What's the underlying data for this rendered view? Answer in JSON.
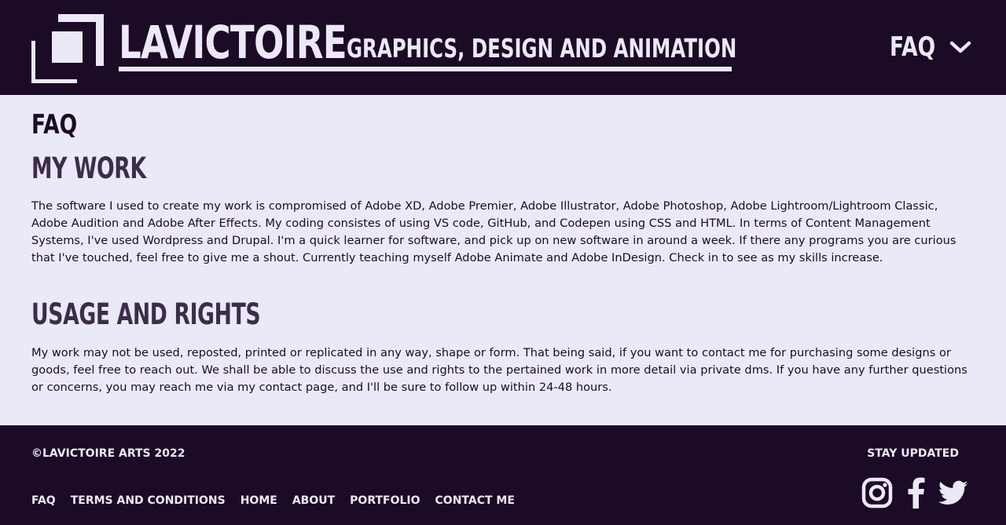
{
  "header": {
    "brand_name": "LAVICTOIRE",
    "tagline": "GRAPHICS, DESIGN AND ANIMATION",
    "nav_label": "FAQ"
  },
  "main": {
    "title": "FAQ",
    "sections": [
      {
        "heading": "MY WORK",
        "body": "The software I used to create my work is compromised of Adobe XD, Adobe Premier, Adobe Illustrator, Adobe Photoshop, Adobe Lightroom/Lightroom Classic, Adobe Audition and Adobe After Effects. My coding consistes of using VS code, GitHub, and Codepen using CSS and HTML. In terms of Content Management Systems, I've used Wordpress and Drupal. I'm a quick learner for software, and pick up on new software in around a week. If there any programs you are curious that I've touched, feel free to give me a shout. Currently teaching myself Adobe Animate and Adobe InDesign. Check in to see as my skills increase."
      },
      {
        "heading": "USAGE AND RIGHTS",
        "body": "My work may not be used, reposted, printed or replicated in any way, shape or form. That being said, if you want to contact me for purchasing some designs or goods, feel free to reach out. We shall be able to discuss the use and rights to the pertained work in more detail via private dms. If you have any further questions or concerns, you may reach me via my contact page, and I'll be sure to follow up within 24-48 hours."
      }
    ]
  },
  "footer": {
    "copyright": "©LAVICTOIRE ARTS 2022",
    "stay_updated": "STAY UPDATED",
    "links": [
      "FAQ",
      "TERMS AND CONDITIONS",
      "HOME",
      "ABOUT",
      "PORTFOLIO",
      "CONTACT ME"
    ],
    "socials": [
      "instagram-icon",
      "facebook-icon",
      "twitter-icon"
    ]
  },
  "colors": {
    "dark": "#1c0b26",
    "light": "#ebe9f8",
    "heading": "#3c2e4a"
  }
}
